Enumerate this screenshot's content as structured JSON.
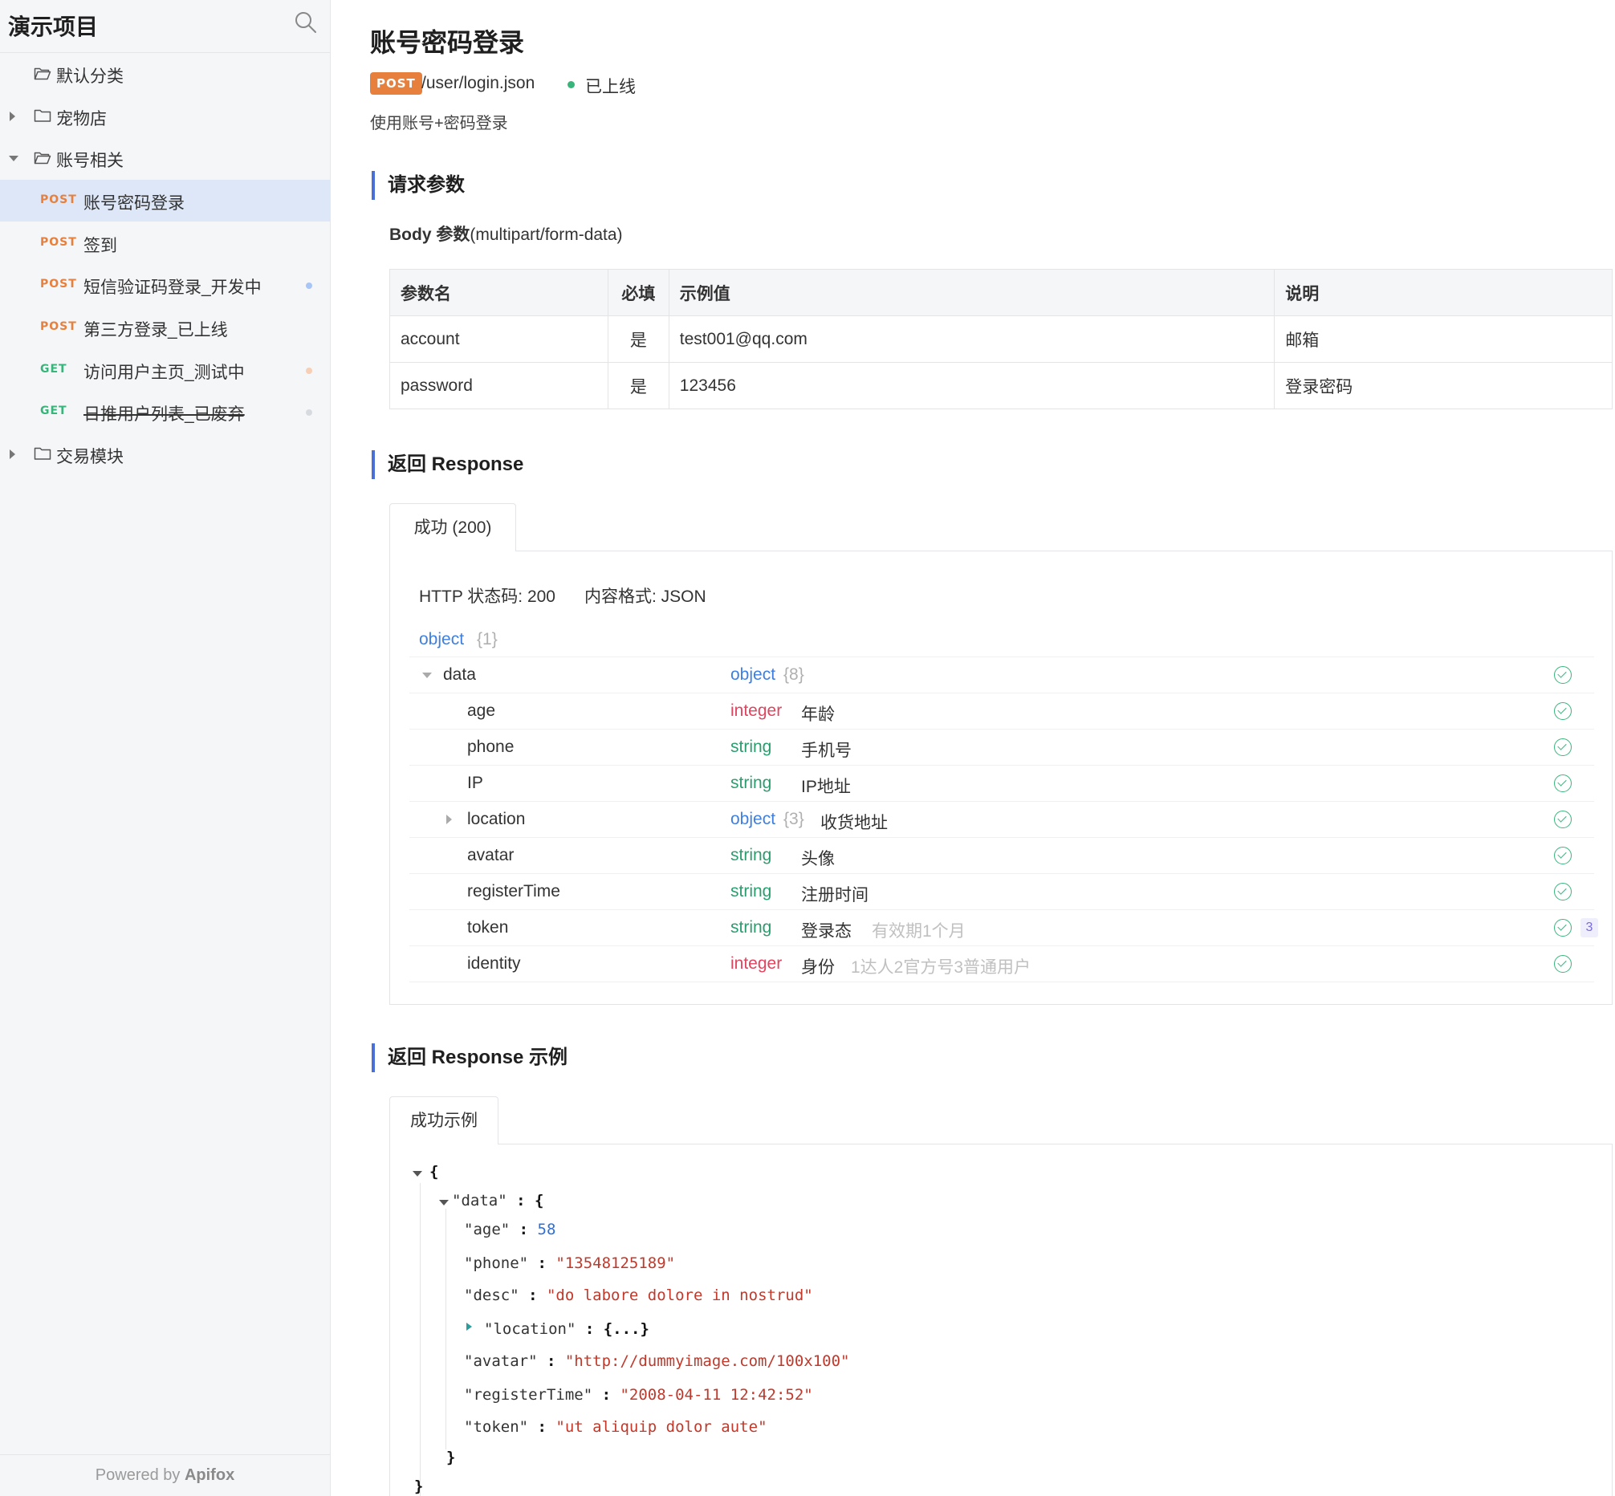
{
  "sidebar": {
    "project_title": "演示项目",
    "search_icon": "search-icon",
    "items": [
      {
        "kind": "folder",
        "label": "默认分类",
        "expanded": true,
        "caret": "none"
      },
      {
        "kind": "folder",
        "label": "宠物店",
        "expanded": false,
        "caret": "right"
      },
      {
        "kind": "folder",
        "label": "账号相关",
        "expanded": true,
        "caret": "down"
      },
      {
        "kind": "api",
        "method": "POST",
        "label": "账号密码登录",
        "active": true,
        "dot": null
      },
      {
        "kind": "api",
        "method": "POST",
        "label": "签到",
        "active": false,
        "dot": null
      },
      {
        "kind": "api",
        "method": "POST",
        "label": "短信验证码登录_开发中",
        "active": false,
        "dot": "#a9c5f5"
      },
      {
        "kind": "api",
        "method": "POST",
        "label": "第三方登录_已上线",
        "active": false,
        "dot": null
      },
      {
        "kind": "api",
        "method": "GET",
        "label": "访问用户主页_测试中",
        "active": false,
        "dot": "#f6cfb4"
      },
      {
        "kind": "api",
        "method": "GET",
        "label": "日推用户列表_已废弃",
        "active": false,
        "dot": "#d7dbe0",
        "strike": true
      },
      {
        "kind": "folder",
        "label": "交易模块",
        "expanded": false,
        "caret": "right"
      }
    ],
    "footer_prefix": "Powered by ",
    "footer_brand": "Apifox"
  },
  "main": {
    "title": "账号密码登录",
    "method": "POST",
    "path": "/user/login.json",
    "status": "已上线",
    "status_color": "#39b57c",
    "description": "使用账号+密码登录",
    "request_section": "请求参数",
    "body_label_bold": "Body 参数",
    "body_label_type": "(multipart/form-data)",
    "params_headers": [
      "参数名",
      "必填",
      "示例值",
      "说明"
    ],
    "params_rows": [
      [
        "account",
        "是",
        "test001@qq.com",
        "邮箱"
      ],
      [
        "password",
        "是",
        "123456",
        "登录密码"
      ]
    ],
    "response_section": "返回 Response",
    "response_tab": "成功 (200)",
    "http_status_label": "HTTP 状态码: 200",
    "content_type_label": "内容格式: JSON",
    "schema_root": {
      "type": "object",
      "count": "{1}"
    },
    "schema_rows": [
      {
        "name": "data",
        "type": "object",
        "count": "{8}",
        "desc": "",
        "note": "",
        "level": 0,
        "caret": "down"
      },
      {
        "name": "age",
        "type": "integer",
        "count": "",
        "desc": "年龄",
        "note": "",
        "level": 1
      },
      {
        "name": "phone",
        "type": "string",
        "count": "",
        "desc": "手机号",
        "note": "",
        "level": 1
      },
      {
        "name": "IP",
        "type": "string",
        "count": "",
        "desc": "IP地址",
        "note": "",
        "level": 1
      },
      {
        "name": "location",
        "type": "object",
        "count": "{3}",
        "desc": "收货地址",
        "note": "",
        "level": 1,
        "caret": "right"
      },
      {
        "name": "avatar",
        "type": "string",
        "count": "",
        "desc": "头像",
        "note": "",
        "level": 1
      },
      {
        "name": "registerTime",
        "type": "string",
        "count": "",
        "desc": "注册时间",
        "note": "",
        "level": 1
      },
      {
        "name": "token",
        "type": "string",
        "count": "",
        "desc": "登录态",
        "note": "有效期1个月",
        "level": 1,
        "badge": "3"
      },
      {
        "name": "identity",
        "type": "integer",
        "count": "",
        "desc": "身份",
        "note": "1达人2官方号3普通用户",
        "level": 1
      }
    ],
    "example_section": "返回 Response 示例",
    "example_tab": "成功示例",
    "example_json": {
      "open_brace": "{",
      "data_key": "\"data\"",
      "age_key": "\"age\"",
      "age_val": "58",
      "phone_key": "\"phone\"",
      "phone_val": "\"13548125189\"",
      "desc_key": "\"desc\"",
      "desc_val": "\"do labore dolore in nostrud\"",
      "location_key": "\"location\"",
      "location_collapsed": "{...}",
      "avatar_key": "\"avatar\"",
      "avatar_val": "\"http://dummyimage.com/100x100\"",
      "registerTime_key": "\"registerTime\"",
      "registerTime_val": "\"2008-04-11 12:42:52\"",
      "token_key": "\"token\"",
      "token_val": "\"ut aliquip dolor aute\"",
      "close_brace": "}"
    }
  },
  "colors": {
    "accent": "#4a6fd6",
    "post": "#e8803d",
    "get": "#39b57c",
    "active_bg": "#dde7f7"
  }
}
